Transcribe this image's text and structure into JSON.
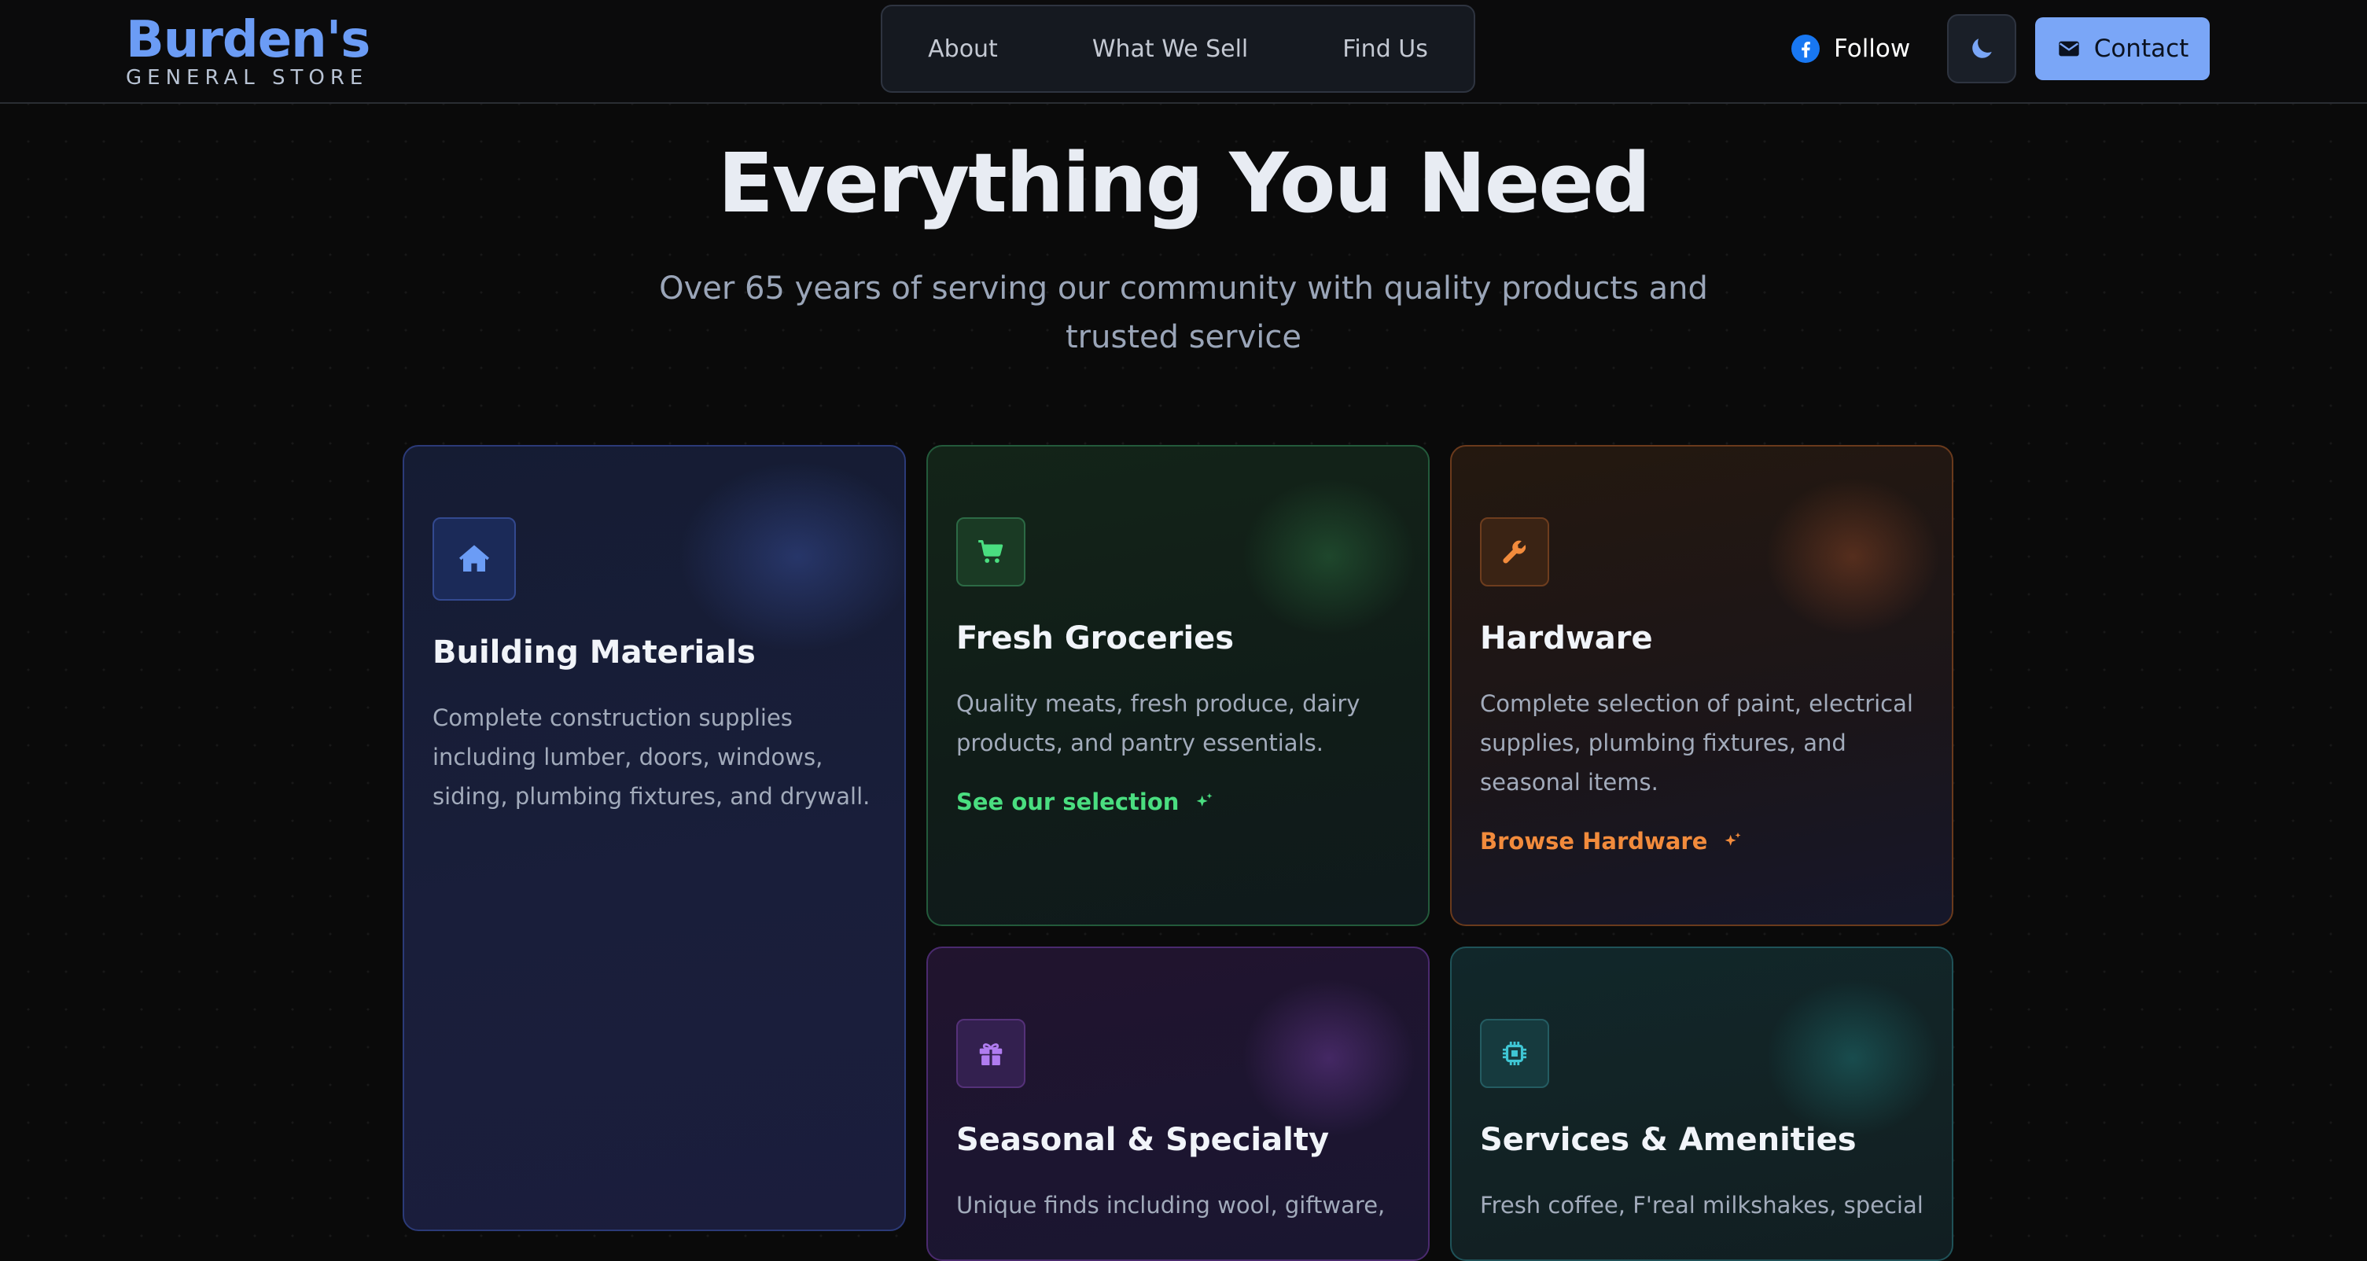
{
  "brand": {
    "name": "Burden's",
    "tagline": "GENERAL STORE"
  },
  "nav": {
    "links": [
      "About",
      "What We Sell",
      "Find Us"
    ]
  },
  "header": {
    "follow_label": "Follow",
    "contact_label": "Contact",
    "follow_icon": "facebook-icon",
    "theme_icon": "moon-icon",
    "contact_icon": "envelope-icon"
  },
  "hero": {
    "title": "Everything You Need",
    "subtitle": "Over 65 years of serving our community with quality products and trusted service"
  },
  "cards": [
    {
      "title": "Building Materials",
      "description": "Complete construction supplies including lumber, doors, windows, siding, plumbing fixtures, and drywall.",
      "icon": "house-icon",
      "accent": "#6b9cf5"
    },
    {
      "title": "Fresh Groceries",
      "description": "Quality meats, fresh produce, dairy products, and pantry essentials.",
      "link": "See our selection",
      "icon": "cart-icon",
      "accent": "#4ade80"
    },
    {
      "title": "Hardware",
      "description": "Complete selection of paint, electrical supplies, plumbing fixtures, and seasonal items.",
      "link": "Browse Hardware",
      "icon": "wrench-icon",
      "accent": "#f28b3c"
    },
    {
      "title": "Seasonal & Specialty",
      "description": "Unique finds including wool, giftware,",
      "icon": "gift-icon",
      "accent": "#b07cf0"
    },
    {
      "title": "Services & Amenities",
      "description": "Fresh coffee, F'real milkshakes, special",
      "icon": "chip-icon",
      "accent": "#3fc6d4"
    }
  ],
  "colors": {
    "background": "#0a0a0a",
    "primary": "#7aa6f7",
    "groceries": "#4ade80",
    "hardware": "#f28b3c",
    "seasonal": "#b07cf0",
    "services": "#3fc6d4"
  }
}
